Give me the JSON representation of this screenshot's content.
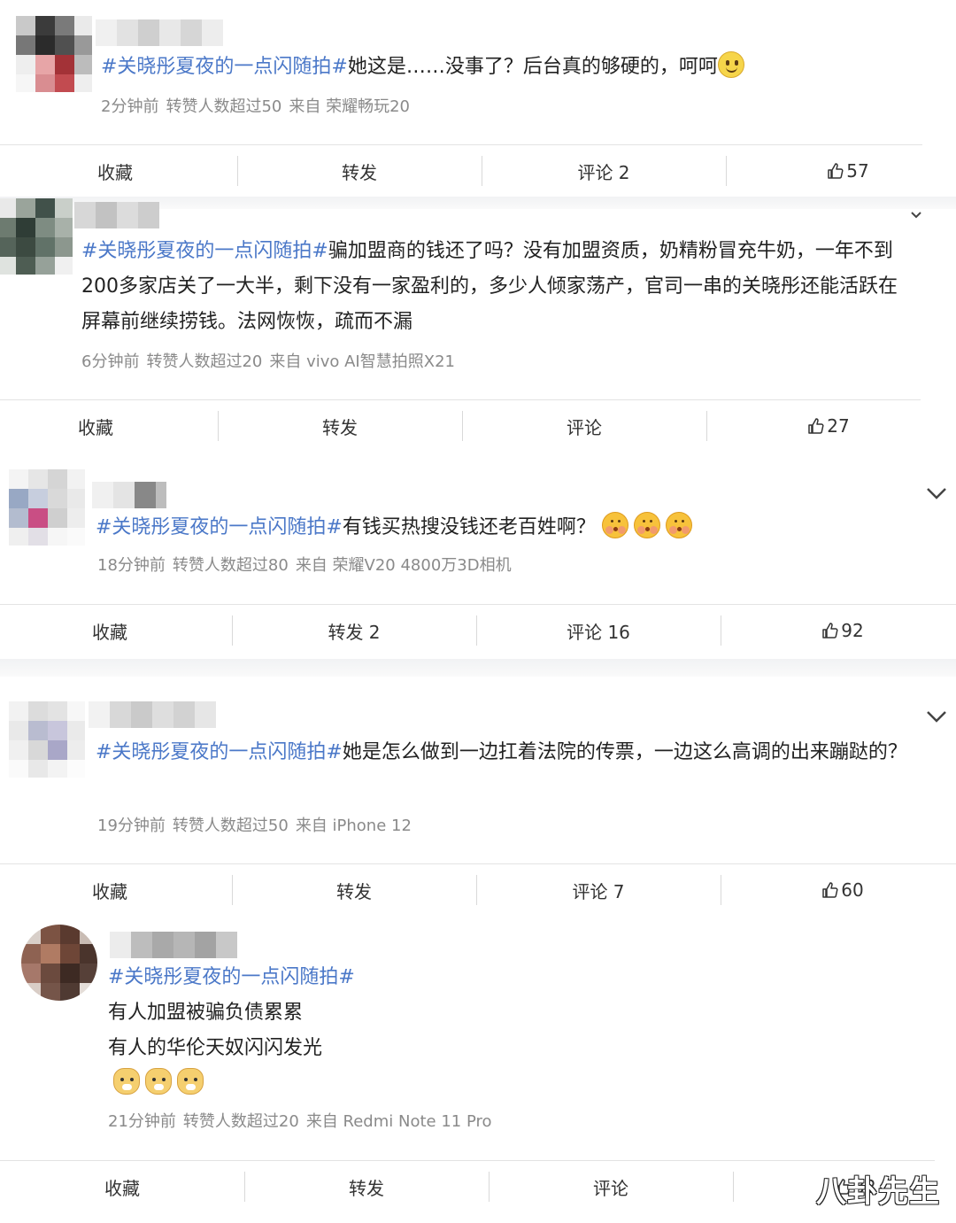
{
  "posts": [
    {
      "hashtag": "#关晓彤夏夜的一点闪随拍#",
      "lines": [
        "她这是……没事了？后台真的够硬的，呵呵"
      ],
      "time": "2分钟前",
      "reposts": "转赞人数超过50",
      "source": "来自 荣耀畅玩20",
      "actions": {
        "fav": "收藏",
        "repost": "转发",
        "comment": "评论 2",
        "like": "57"
      }
    },
    {
      "hashtag": "#关晓彤夏夜的一点闪随拍#",
      "lines": [
        "骗加盟商的钱还了吗？没有加盟资质，奶精粉冒充牛奶，一年不到",
        "200多家店关了一大半，剩下没有一家盈利的，多少人倾家荡产，官司一串的关晓彤还能活跃在",
        "屏幕前继续捞钱。法网恢恢，疏而不漏"
      ],
      "time": "6分钟前",
      "reposts": "转赞人数超过20",
      "source": "来自 vivo AI智慧拍照X21",
      "actions": {
        "fav": "收藏",
        "repost": "转发",
        "comment": "评论",
        "like": "27"
      }
    },
    {
      "hashtag": "#关晓彤夏夜的一点闪随拍#",
      "lines": [
        "有钱买热搜没钱还老百姓啊？"
      ],
      "time": "18分钟前",
      "reposts": "转赞人数超过80",
      "source": "来自 荣耀V20 4800万3D相机",
      "actions": {
        "fav": "收藏",
        "repost": "转发 2",
        "comment": "评论 16",
        "like": "92"
      }
    },
    {
      "hashtag": "#关晓彤夏夜的一点闪随拍#",
      "lines": [
        "她是怎么做到一边扛着法院的传票，一边这么高调的出来蹦跶的？"
      ],
      "time": "19分钟前",
      "reposts": "转赞人数超过50",
      "source": "来自 iPhone 12",
      "actions": {
        "fav": "收藏",
        "repost": "转发",
        "comment": "评论 7",
        "like": "60"
      }
    },
    {
      "hashtag": "#关晓彤夏夜的一点闪随拍#",
      "lines": [
        "有人加盟被骗负债累累",
        "有人的华伦天奴闪闪发光"
      ],
      "time": "21分钟前",
      "reposts": "转赞人数超过20",
      "source": "来自 Redmi Note 11 Pro",
      "actions": {
        "fav": "收藏",
        "repost": "转发",
        "comment": "评论",
        "like": "32"
      }
    }
  ],
  "watermark": "八卦先生",
  "colors": {
    "hashtag": "#4b78c8",
    "meta": "#8a8a8a",
    "text": "#222222"
  },
  "icons": {
    "like": "thumbs-up-icon",
    "expand": "chevron-down-icon",
    "emoji_smile": "smile-emoji",
    "emoji_shy": "shy-emoji",
    "emoji_dog": "dog-emoji"
  }
}
